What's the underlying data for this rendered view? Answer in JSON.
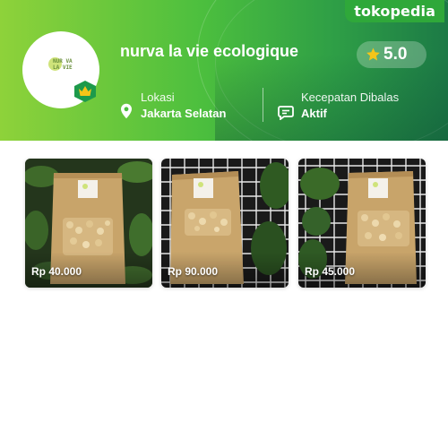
{
  "brand": {
    "name": "tokopedia"
  },
  "shop": {
    "name": "nurva la vie ecologique",
    "logo_text": "NUR VA LA VIE",
    "rating": "5.0",
    "location_label": "Lokasi",
    "location_value": "Jakarta Selatan",
    "response_label": "Kecepatan Dibalas",
    "response_value": "Aktif"
  },
  "products": [
    {
      "price": "Rp 40.000",
      "background": "plants"
    },
    {
      "price": "Rp 90.000",
      "background": "grid"
    },
    {
      "price": "Rp 45.000",
      "background": "grid-plant"
    }
  ],
  "colors": {
    "header_start": "#8ed23a",
    "header_end": "#1c7a46",
    "brand_bg": "#2fa83a",
    "star": "#f5c518",
    "badge": "#1d9a4b"
  },
  "icons": {
    "rating": "star-icon",
    "location": "location-pin-icon",
    "response": "chat-bubble-icon",
    "badge": "crown-icon"
  }
}
